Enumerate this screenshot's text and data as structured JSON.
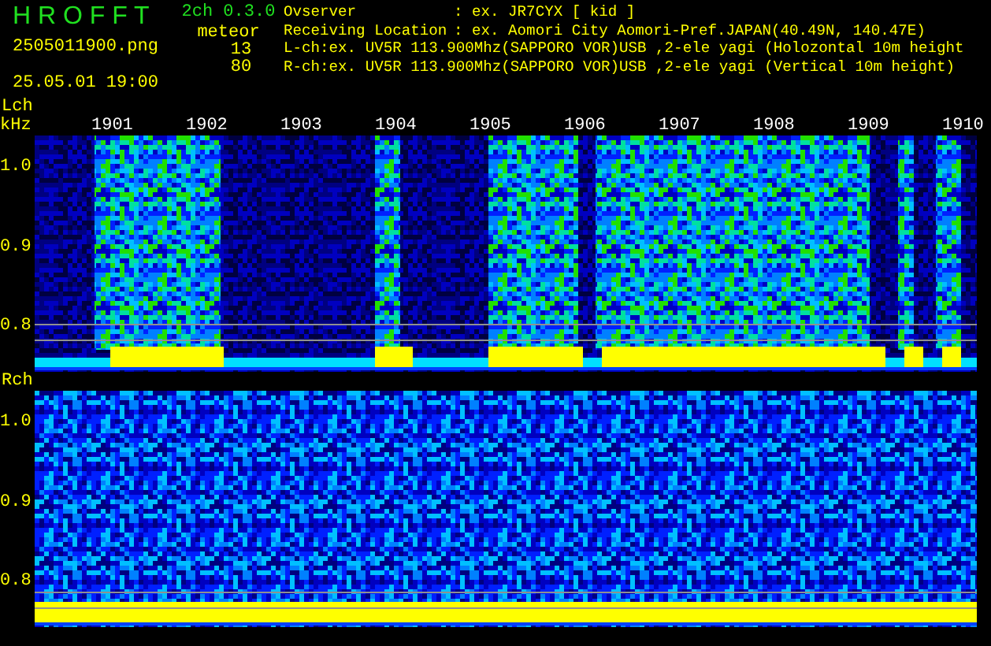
{
  "app": {
    "name": "H R O F F T",
    "version": "2ch 0.3.0"
  },
  "file": {
    "name": "2505011900.png",
    "datetime": "25.05.01 19:00"
  },
  "counts": {
    "label": "meteor",
    "lch": "13",
    "rch": "80"
  },
  "info": [
    {
      "label": "Ovserver",
      "value": ": ex. JR7CYX [ kid ]"
    },
    {
      "label": "Receiving Location",
      "value": ": ex. Aomori City Aomori-Pref.JAPAN(40.49N, 140.47E)"
    }
  ],
  "channels_info": [
    "L-ch:ex. UV5R 113.900Mhz(SAPPORO VOR)USB ,2-ele yagi (Holozontal 10m height",
    "R-ch:ex. UV5R 113.900Mhz(SAPPORO VOR)USB ,2-ele yagi (Vertical 10m height)"
  ],
  "panels": [
    {
      "label": "Lch",
      "unit": "kHz",
      "kind": "active",
      "time_labels": [
        "1901",
        "1902",
        "1903",
        "1904",
        "1905",
        "1906",
        "1907",
        "1908",
        "1909",
        "1910"
      ],
      "ticks": [
        "1.0",
        "0.9",
        "0.8"
      ]
    },
    {
      "label": "Rch",
      "kind": "noise",
      "ticks": [
        "1.0",
        "0.9",
        "0.8"
      ]
    }
  ]
}
